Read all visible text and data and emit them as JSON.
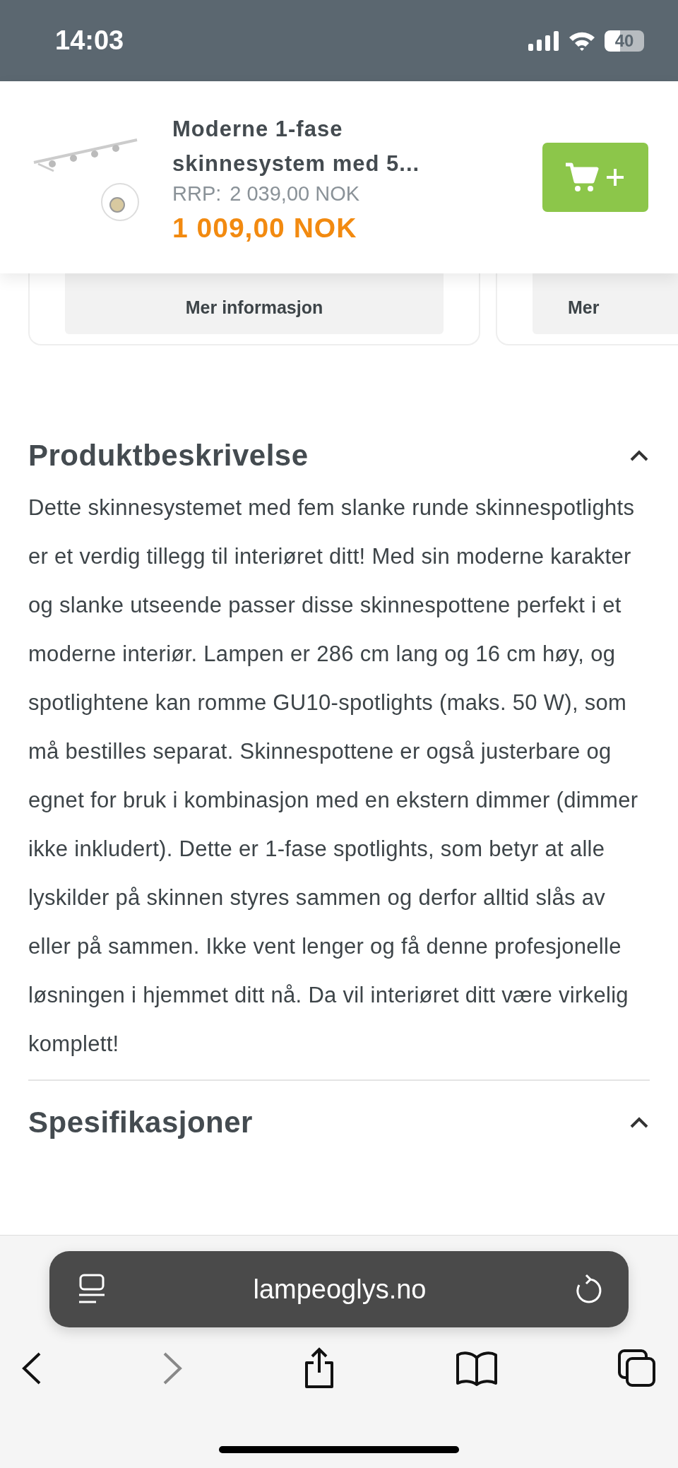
{
  "status_bar": {
    "time": "14:03",
    "battery": "40"
  },
  "sticky_product": {
    "title_lines": [
      "Moderne 1-fase",
      "skinnesystem med 5..."
    ],
    "rrp_label": "RRP:",
    "rrp_price": "2 039,00 NOK",
    "price": "1 009,00 NOK"
  },
  "cards": [
    {
      "button": "Mer informasjon"
    },
    {
      "button": "Mer"
    }
  ],
  "sections": [
    {
      "title": "Produktbeskrivelse",
      "expanded": true,
      "text": "Dette skinnesystemet med fem slanke runde skinnespotlights er et verdig tillegg til interiøret ditt! Med sin moderne karakter og slanke utseende passer disse skinnespottene perfekt i et moderne interiør. Lampen er 286 cm lang og 16 cm høy, og spotlightene kan romme GU10-spotlights (maks. 50 W), som må bestilles separat. Skinnespottene er også justerbare og egnet for bruk i kombinasjon med en ekstern dimmer (dimmer ikke inkludert). Dette er 1-fase spotlights, som betyr at alle lyskilder på skinnen styres sammen og derfor alltid slås av eller på sammen. Ikke vent lenger og få denne profesjonelle løsningen i hjemmet ditt nå. Da vil interiøret ditt være virkelig komplett!"
    },
    {
      "title": "Spesifikasjoner",
      "expanded": true
    }
  ],
  "browser": {
    "url": "lampeoglys.no",
    "forward_disabled": true
  }
}
